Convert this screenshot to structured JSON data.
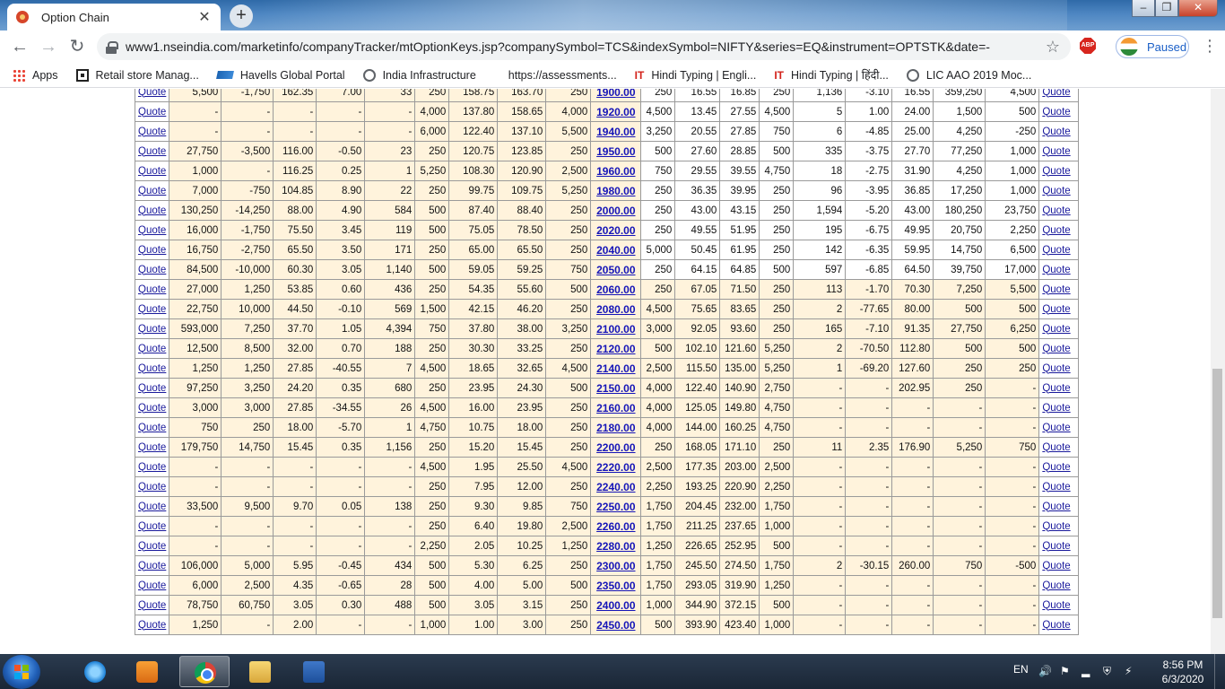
{
  "browser": {
    "tab_title": "Option Chain",
    "new_tab_symbol": "+",
    "url": "www1.nseindia.com/marketinfo/companyTracker/mtOptionKeys.jsp?companySymbol=TCS&indexSymbol=NIFTY&series=EQ&instrument=OPTSTK&date=-",
    "profile_status": "Paused",
    "abp_label": "ABP"
  },
  "bookmarks": [
    {
      "label": "Apps",
      "icon": "apps-grid-icon"
    },
    {
      "label": "Retail store Manag...",
      "icon": "box-icon"
    },
    {
      "label": "Havells Global Portal",
      "icon": "sap-icon"
    },
    {
      "label": "India Infrastructure",
      "icon": "globe-icon"
    },
    {
      "label": "https://assessments...",
      "icon": "blank-icon"
    },
    {
      "label": "Hindi Typing | Engli...",
      "icon": "it-icon"
    },
    {
      "label": "Hindi Typing | हिंदी...",
      "icon": "it-icon"
    },
    {
      "label": "LIC AAO 2019 Moc...",
      "icon": "globe-icon"
    }
  ],
  "table": {
    "quote_label": "Quote",
    "rows": [
      [
        "5,500",
        "-1,750",
        "162.35",
        "7.00",
        "33",
        "250",
        "158.75",
        "163.70",
        "250",
        "1900.00",
        "250",
        "16.55",
        "16.85",
        "250",
        "1,136",
        "-3.10",
        "16.55",
        "359,250",
        "4,500"
      ],
      [
        "-",
        "-",
        "-",
        "-",
        "-",
        "4,000",
        "137.80",
        "158.65",
        "4,000",
        "1920.00",
        "4,500",
        "13.45",
        "27.55",
        "4,500",
        "5",
        "1.00",
        "24.00",
        "1,500",
        "500"
      ],
      [
        "-",
        "-",
        "-",
        "-",
        "-",
        "6,000",
        "122.40",
        "137.10",
        "5,500",
        "1940.00",
        "3,250",
        "20.55",
        "27.85",
        "750",
        "6",
        "-4.85",
        "25.00",
        "4,250",
        "-250"
      ],
      [
        "27,750",
        "-3,500",
        "116.00",
        "-0.50",
        "23",
        "250",
        "120.75",
        "123.85",
        "250",
        "1950.00",
        "500",
        "27.60",
        "28.85",
        "500",
        "335",
        "-3.75",
        "27.70",
        "77,250",
        "1,000"
      ],
      [
        "1,000",
        "-",
        "116.25",
        "0.25",
        "1",
        "5,250",
        "108.30",
        "120.90",
        "2,500",
        "1960.00",
        "750",
        "29.55",
        "39.55",
        "4,750",
        "18",
        "-2.75",
        "31.90",
        "4,250",
        "1,000"
      ],
      [
        "7,000",
        "-750",
        "104.85",
        "8.90",
        "22",
        "250",
        "99.75",
        "109.75",
        "5,250",
        "1980.00",
        "250",
        "36.35",
        "39.95",
        "250",
        "96",
        "-3.95",
        "36.85",
        "17,250",
        "1,000"
      ],
      [
        "130,250",
        "-14,250",
        "88.00",
        "4.90",
        "584",
        "500",
        "87.40",
        "88.40",
        "250",
        "2000.00",
        "250",
        "43.00",
        "43.15",
        "250",
        "1,594",
        "-5.20",
        "43.00",
        "180,250",
        "23,750"
      ],
      [
        "16,000",
        "-1,750",
        "75.50",
        "3.45",
        "119",
        "500",
        "75.05",
        "78.50",
        "250",
        "2020.00",
        "250",
        "49.55",
        "51.95",
        "250",
        "195",
        "-6.75",
        "49.95",
        "20,750",
        "2,250"
      ],
      [
        "16,750",
        "-2,750",
        "65.50",
        "3.50",
        "171",
        "250",
        "65.00",
        "65.50",
        "250",
        "2040.00",
        "5,000",
        "50.45",
        "61.95",
        "250",
        "142",
        "-6.35",
        "59.95",
        "14,750",
        "6,500"
      ],
      [
        "84,500",
        "-10,000",
        "60.30",
        "3.05",
        "1,140",
        "500",
        "59.05",
        "59.25",
        "750",
        "2050.00",
        "250",
        "64.15",
        "64.85",
        "500",
        "597",
        "-6.85",
        "64.50",
        "39,750",
        "17,000"
      ],
      [
        "27,000",
        "1,250",
        "53.85",
        "0.60",
        "436",
        "250",
        "54.35",
        "55.60",
        "500",
        "2060.00",
        "250",
        "67.05",
        "71.50",
        "250",
        "113",
        "-1.70",
        "70.30",
        "7,250",
        "5,500"
      ],
      [
        "22,750",
        "10,000",
        "44.50",
        "-0.10",
        "569",
        "1,500",
        "42.15",
        "46.20",
        "250",
        "2080.00",
        "4,500",
        "75.65",
        "83.65",
        "250",
        "2",
        "-77.65",
        "80.00",
        "500",
        "500"
      ],
      [
        "593,000",
        "7,250",
        "37.70",
        "1.05",
        "4,394",
        "750",
        "37.80",
        "38.00",
        "3,250",
        "2100.00",
        "3,000",
        "92.05",
        "93.60",
        "250",
        "165",
        "-7.10",
        "91.35",
        "27,750",
        "6,250"
      ],
      [
        "12,500",
        "8,500",
        "32.00",
        "0.70",
        "188",
        "250",
        "30.30",
        "33.25",
        "250",
        "2120.00",
        "500",
        "102.10",
        "121.60",
        "5,250",
        "2",
        "-70.50",
        "112.80",
        "500",
        "500"
      ],
      [
        "1,250",
        "1,250",
        "27.85",
        "-40.55",
        "7",
        "4,500",
        "18.65",
        "32.65",
        "4,500",
        "2140.00",
        "2,500",
        "115.50",
        "135.00",
        "5,250",
        "1",
        "-69.20",
        "127.60",
        "250",
        "250"
      ],
      [
        "97,250",
        "3,250",
        "24.20",
        "0.35",
        "680",
        "250",
        "23.95",
        "24.30",
        "500",
        "2150.00",
        "4,000",
        "122.40",
        "140.90",
        "2,750",
        "-",
        "-",
        "202.95",
        "250",
        "-"
      ],
      [
        "3,000",
        "3,000",
        "27.85",
        "-34.55",
        "26",
        "4,500",
        "16.00",
        "23.95",
        "250",
        "2160.00",
        "4,000",
        "125.05",
        "149.80",
        "4,750",
        "-",
        "-",
        "-",
        "-",
        "-"
      ],
      [
        "750",
        "250",
        "18.00",
        "-5.70",
        "1",
        "4,750",
        "10.75",
        "18.00",
        "250",
        "2180.00",
        "4,000",
        "144.00",
        "160.25",
        "4,750",
        "-",
        "-",
        "-",
        "-",
        "-"
      ],
      [
        "179,750",
        "14,750",
        "15.45",
        "0.35",
        "1,156",
        "250",
        "15.20",
        "15.45",
        "250",
        "2200.00",
        "250",
        "168.05",
        "171.10",
        "250",
        "11",
        "2.35",
        "176.90",
        "5,250",
        "750"
      ],
      [
        "-",
        "-",
        "-",
        "-",
        "-",
        "4,500",
        "1.95",
        "25.50",
        "4,500",
        "2220.00",
        "2,500",
        "177.35",
        "203.00",
        "2,500",
        "-",
        "-",
        "-",
        "-",
        "-"
      ],
      [
        "-",
        "-",
        "-",
        "-",
        "-",
        "250",
        "7.95",
        "12.00",
        "250",
        "2240.00",
        "2,250",
        "193.25",
        "220.90",
        "2,250",
        "-",
        "-",
        "-",
        "-",
        "-"
      ],
      [
        "33,500",
        "9,500",
        "9.70",
        "0.05",
        "138",
        "250",
        "9.30",
        "9.85",
        "750",
        "2250.00",
        "1,750",
        "204.45",
        "232.00",
        "1,750",
        "-",
        "-",
        "-",
        "-",
        "-"
      ],
      [
        "-",
        "-",
        "-",
        "-",
        "-",
        "250",
        "6.40",
        "19.80",
        "2,500",
        "2260.00",
        "1,750",
        "211.25",
        "237.65",
        "1,000",
        "-",
        "-",
        "-",
        "-",
        "-"
      ],
      [
        "-",
        "-",
        "-",
        "-",
        "-",
        "2,250",
        "2.05",
        "10.25",
        "1,250",
        "2280.00",
        "1,250",
        "226.65",
        "252.95",
        "500",
        "-",
        "-",
        "-",
        "-",
        "-"
      ],
      [
        "106,000",
        "5,000",
        "5.95",
        "-0.45",
        "434",
        "500",
        "5.30",
        "6.25",
        "250",
        "2300.00",
        "1,750",
        "245.50",
        "274.50",
        "1,750",
        "2",
        "-30.15",
        "260.00",
        "750",
        "-500"
      ],
      [
        "6,000",
        "2,500",
        "4.35",
        "-0.65",
        "28",
        "500",
        "4.00",
        "5.00",
        "500",
        "2350.00",
        "1,750",
        "293.05",
        "319.90",
        "1,250",
        "-",
        "-",
        "-",
        "-",
        "-"
      ],
      [
        "78,750",
        "60,750",
        "3.05",
        "0.30",
        "488",
        "500",
        "3.05",
        "3.15",
        "250",
        "2400.00",
        "1,000",
        "344.90",
        "372.15",
        "500",
        "-",
        "-",
        "-",
        "-",
        "-"
      ],
      [
        "1,250",
        "-",
        "2.00",
        "-",
        "-",
        "1,000",
        "1.00",
        "3.00",
        "250",
        "2450.00",
        "500",
        "393.90",
        "423.40",
        "1,000",
        "-",
        "-",
        "-",
        "-",
        "-"
      ]
    ]
  },
  "taskbar": {
    "language": "EN",
    "time": "8:56 PM",
    "date": "6/3/2020"
  },
  "colors": {
    "itm_cell": "#fff3dc",
    "strike_link": "#1515b8",
    "quote_link": "#1a1a9c"
  }
}
